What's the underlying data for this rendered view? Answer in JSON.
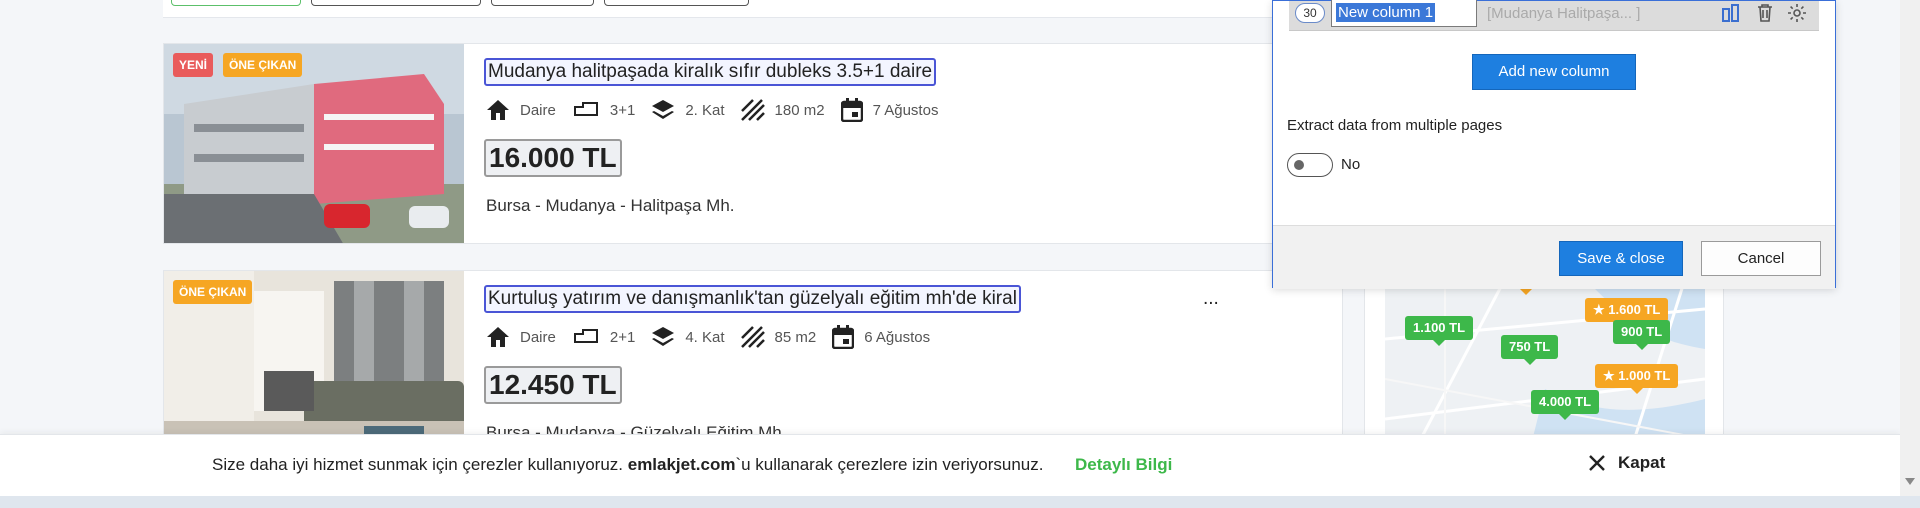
{
  "listings": [
    {
      "badges": [
        "YENİ",
        "ÖNE ÇIKAN"
      ],
      "title": "Mudanya halitpaşada kiralık sıfır dubleks 3.5+1 daire",
      "type": "Daire",
      "rooms": "3+1",
      "floor": "2. Kat",
      "area": "180 m2",
      "date": "7 Ağustos",
      "price": "16.000 TL",
      "location": "Bursa - Mudanya - Halitpaşa Mh."
    },
    {
      "badges": [
        "ÖNE ÇIKAN"
      ],
      "title": "Kurtuluş yatırım ve danışmanlık'tan güzelyalı eğitim mh'de kiral",
      "title_overflow": "...",
      "type": "Daire",
      "rooms": "2+1",
      "floor": "4. Kat",
      "area": "85 m2",
      "date": "6 Ağustos",
      "price": "12.450 TL",
      "location": "Bursa - Mudanya - Güzelyalı Eğitim Mh."
    }
  ],
  "map": {
    "pins": [
      {
        "label": "1.100 TL",
        "color": "green",
        "star": false
      },
      {
        "label": "1.600 TL",
        "color": "orange",
        "star": true
      },
      {
        "label": "900 TL",
        "color": "green",
        "star": false
      },
      {
        "label": "750 TL",
        "color": "green",
        "star": false
      },
      {
        "label": "1.000 TL",
        "color": "orange",
        "star": true
      },
      {
        "label": "4.000 TL",
        "color": "green",
        "star": false
      }
    ]
  },
  "dialog": {
    "column": {
      "count": "30",
      "name": "New column 1",
      "preview": "[Mudanya Halitpaşa...  ]"
    },
    "add_column_label": "Add new column",
    "extract_label": "Extract data from multiple pages",
    "toggle_label": "No",
    "save_label": "Save & close",
    "cancel_label": "Cancel"
  },
  "cookie": {
    "text_before": "Size daha iyi hizmet sunmak için çerezler kullanıyoruz. ",
    "brand": "emlakjet.com",
    "text_after": "`u kullanarak çerezlere izin veriyorsunuz.",
    "link": "Detaylı Bilgi",
    "close": "Kapat"
  },
  "colors": {
    "accent_blue": "#1e7fe0",
    "green": "#3db84a",
    "orange": "#f6a623",
    "badge_red": "#e95b5b"
  }
}
